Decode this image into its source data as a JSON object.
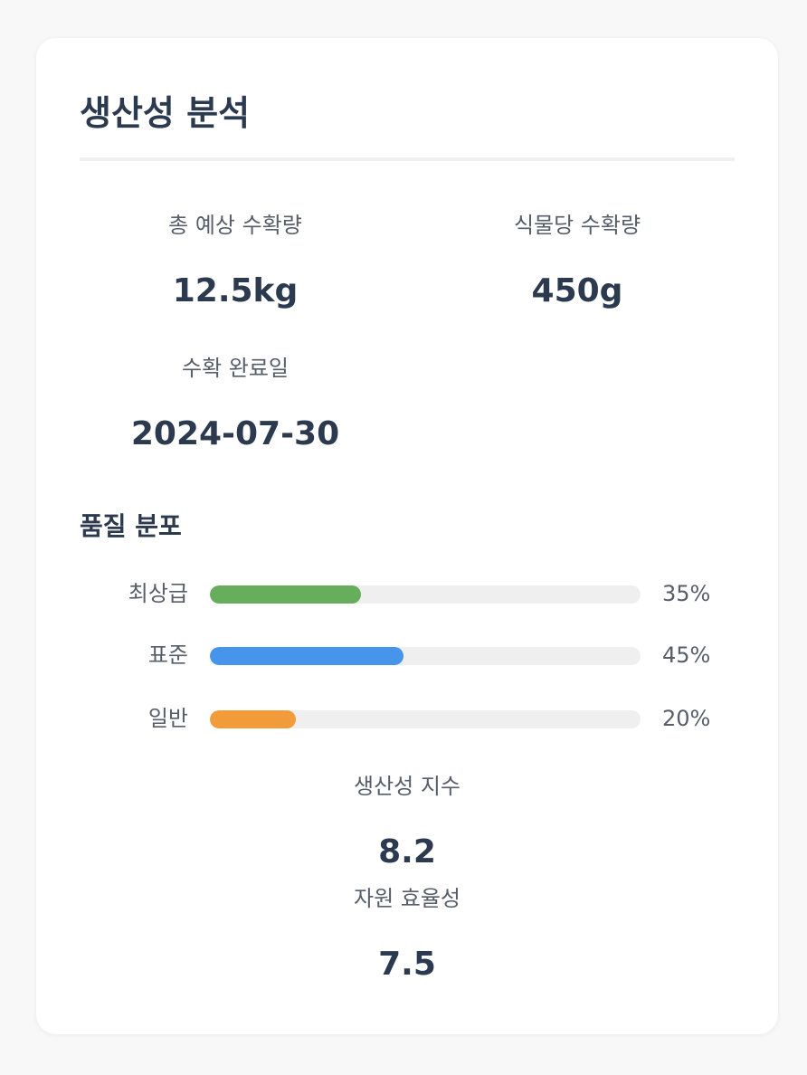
{
  "card": {
    "title": "생산성 분석"
  },
  "metrics": {
    "total_yield": {
      "label": "총 예상 수확량",
      "value": "12.5kg"
    },
    "per_plant": {
      "label": "식물당 수확량",
      "value": "450g"
    },
    "harvest_date": {
      "label": "수확 완료일",
      "value": "2024-07-30"
    }
  },
  "quality": {
    "title": "품질 분포",
    "items": [
      {
        "label": "최상급",
        "percent": 35,
        "percent_text": "35%",
        "color": "#66ad5c"
      },
      {
        "label": "표준",
        "percent": 45,
        "percent_text": "45%",
        "color": "#4795ea"
      },
      {
        "label": "일반",
        "percent": 20,
        "percent_text": "20%",
        "color": "#f19b3a"
      }
    ]
  },
  "indices": {
    "productivity": {
      "label": "생산성 지수",
      "value": "8.2"
    },
    "resource_efficiency": {
      "label": "자원 효율성",
      "value": "7.5"
    }
  }
}
